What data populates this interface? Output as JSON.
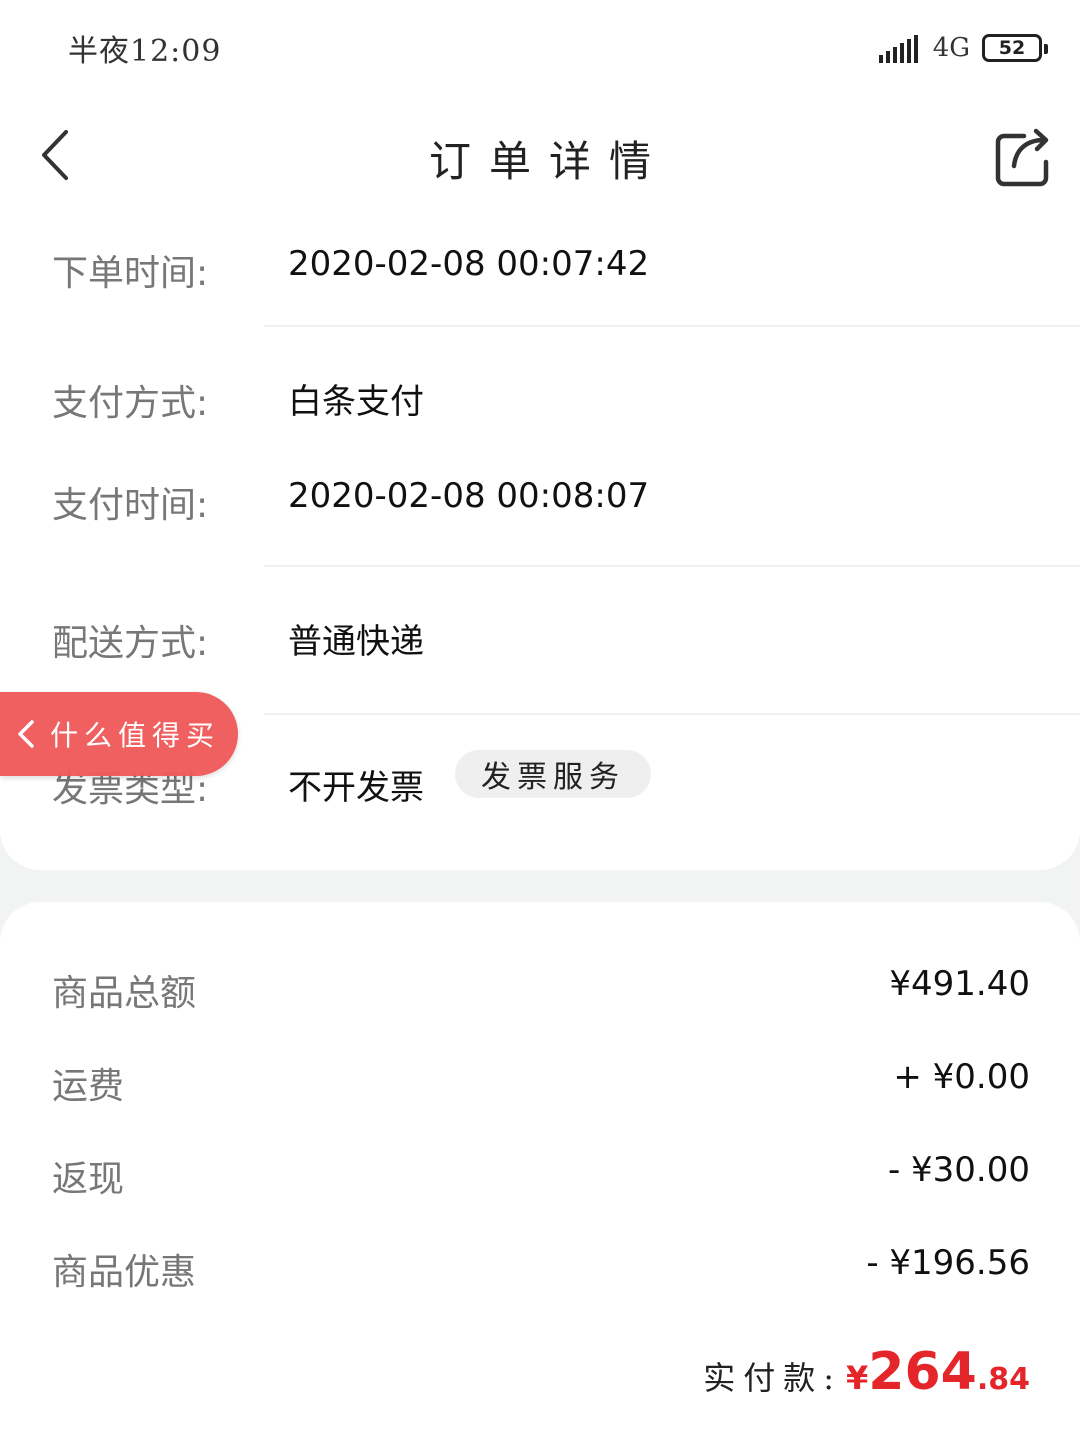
{
  "status_bar": {
    "time": "半夜12:09",
    "network": "4G",
    "battery": "52"
  },
  "header": {
    "title": "订单详情"
  },
  "order_info": {
    "order_time": {
      "label": "下单时间:",
      "value": "2020-02-08 00:07:42"
    },
    "pay_method": {
      "label": "支付方式:",
      "value": "白条支付"
    },
    "pay_time": {
      "label": "支付时间:",
      "value": "2020-02-08 00:08:07"
    },
    "delivery": {
      "label": "配送方式:",
      "value": "普通快递"
    },
    "invoice": {
      "label": "发票类型:",
      "value": "不开发票",
      "tag": "发票服务"
    }
  },
  "floating_pill": {
    "label": "什么值得买"
  },
  "summary": {
    "rows": [
      {
        "label": "商品总额",
        "value": "¥491.40"
      },
      {
        "label": "运费",
        "value": "+ ¥0.00"
      },
      {
        "label": "返现",
        "value": "- ¥30.00"
      },
      {
        "label": "商品优惠",
        "value": "- ¥196.56"
      }
    ],
    "paid_label": "实付款:",
    "paid_currency": "¥",
    "paid_integer": "264",
    "paid_decimal": ".84"
  },
  "colors": {
    "accent_red": "#e4262a",
    "pill_red": "#f05a5a",
    "label_gray": "#777777",
    "background": "#f2f3f3"
  }
}
